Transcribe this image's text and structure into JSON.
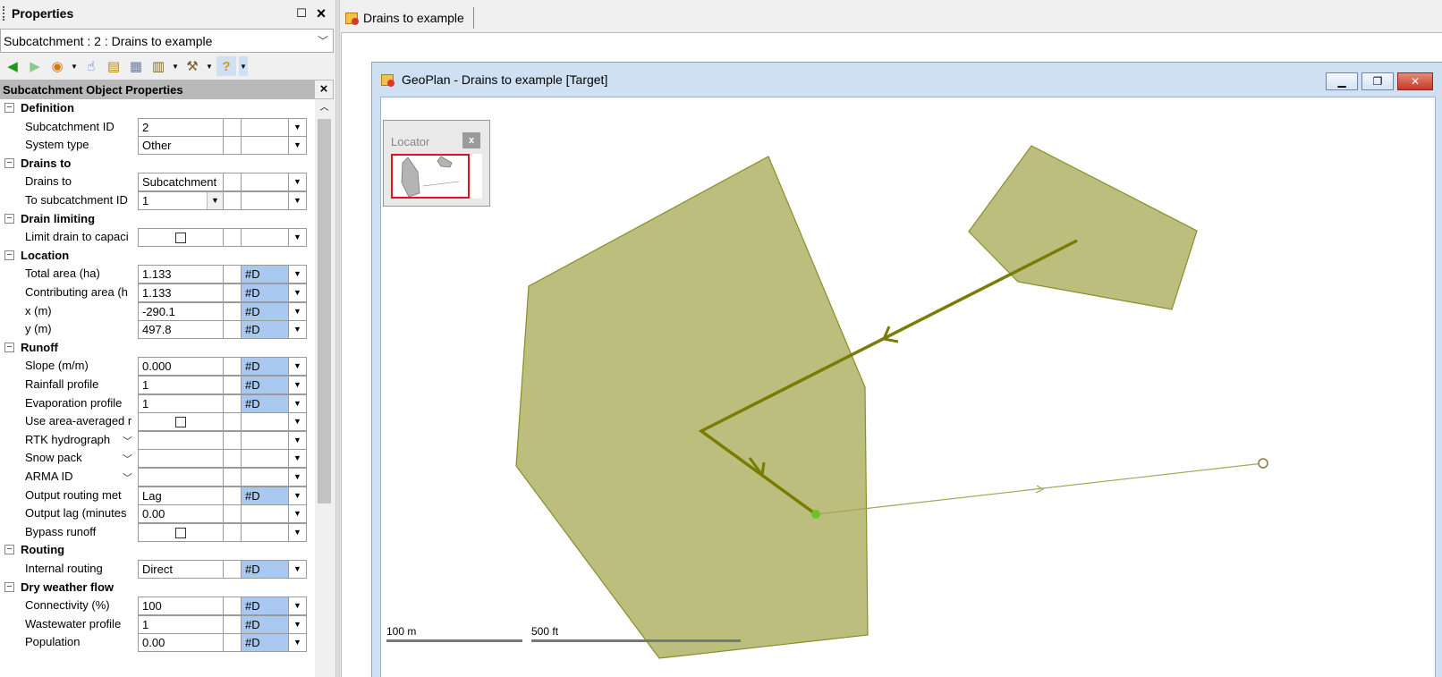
{
  "properties_panel": {
    "title": "Properties",
    "selector_value": "Subcatchment : 2 : Drains to example",
    "section_title": "Subcatchment Object Properties",
    "rows": [
      {
        "type": "cat",
        "label": "Definition"
      },
      {
        "type": "prop",
        "label": "Subcatchment ID",
        "value": "2",
        "flag": "",
        "flag_blue": false
      },
      {
        "type": "prop",
        "label": "System type",
        "value": "Other",
        "flag": "",
        "flag_blue": false
      },
      {
        "type": "cat",
        "label": "Drains to"
      },
      {
        "type": "prop",
        "label": "Drains to",
        "value": "Subcatchment",
        "flag": "",
        "flag_blue": false
      },
      {
        "type": "prop",
        "label": "To subcatchment ID",
        "value": "1",
        "flag": "",
        "flag_blue": false,
        "inline_dd": true
      },
      {
        "type": "cat",
        "label": "Drain limiting"
      },
      {
        "type": "prop",
        "label": "Limit drain to capaci",
        "value": "",
        "check": true,
        "flag": "",
        "flag_blue": false
      },
      {
        "type": "cat",
        "label": "Location"
      },
      {
        "type": "prop",
        "label": "Total area (ha)",
        "value": "1.133",
        "flag": "#D",
        "flag_blue": true
      },
      {
        "type": "prop",
        "label": "Contributing area (h",
        "value": "1.133",
        "flag": "#D",
        "flag_blue": true
      },
      {
        "type": "prop",
        "label": "x (m)",
        "value": "-290.1",
        "flag": "#D",
        "flag_blue": true
      },
      {
        "type": "prop",
        "label": "y (m)",
        "value": "497.8",
        "flag": "#D",
        "flag_blue": true
      },
      {
        "type": "cat",
        "label": "Runoff"
      },
      {
        "type": "prop",
        "label": "Slope (m/m)",
        "value": "0.000",
        "flag": "#D",
        "flag_blue": true
      },
      {
        "type": "prop",
        "label": "Rainfall profile",
        "value": "1",
        "flag": "#D",
        "flag_blue": true
      },
      {
        "type": "prop",
        "label": "Evaporation profile",
        "value": "1",
        "flag": "#D",
        "flag_blue": true
      },
      {
        "type": "prop",
        "label": "Use area-averaged r",
        "value": "",
        "check": true,
        "flag": "",
        "flag_blue": false
      },
      {
        "type": "prop",
        "label": "RTK hydrograph",
        "value": "",
        "flag": "",
        "flag_blue": false,
        "label_dd": true
      },
      {
        "type": "prop",
        "label": "Snow pack",
        "value": "",
        "flag": "",
        "flag_blue": false,
        "label_dd": true
      },
      {
        "type": "prop",
        "label": "ARMA ID",
        "value": "",
        "flag": "",
        "flag_blue": false,
        "label_dd": true
      },
      {
        "type": "prop",
        "label": "Output routing met",
        "value": "Lag",
        "flag": "#D",
        "flag_blue": true
      },
      {
        "type": "prop",
        "label": "Output lag (minutes",
        "value": "0.00",
        "flag": "",
        "flag_blue": false
      },
      {
        "type": "prop",
        "label": "Bypass runoff",
        "value": "",
        "check": true,
        "flag": "",
        "flag_blue": false
      },
      {
        "type": "cat",
        "label": "Routing"
      },
      {
        "type": "prop",
        "label": "Internal routing",
        "value": "Direct",
        "flag": "#D",
        "flag_blue": true
      },
      {
        "type": "cat",
        "label": "Dry weather flow"
      },
      {
        "type": "prop",
        "label": "Connectivity (%)",
        "value": "100",
        "flag": "#D",
        "flag_blue": true
      },
      {
        "type": "prop",
        "label": "Wastewater profile",
        "value": "1",
        "flag": "#D",
        "flag_blue": true
      },
      {
        "type": "prop",
        "label": "Population",
        "value": "0.00",
        "flag": "#D",
        "flag_blue": true
      }
    ]
  },
  "document_tab": {
    "label": "Drains to example"
  },
  "geoplan": {
    "title": "GeoPlan - Drains to example [Target]",
    "locator_label": "Locator",
    "scale_metric": "100 m",
    "scale_imperial": "500 ft",
    "colors": {
      "subcatchment_fill": "#bcbe7e",
      "subcatchment_stroke": "#8a8c2a",
      "link": "#7a7c00",
      "node": "#6cc22a"
    }
  }
}
